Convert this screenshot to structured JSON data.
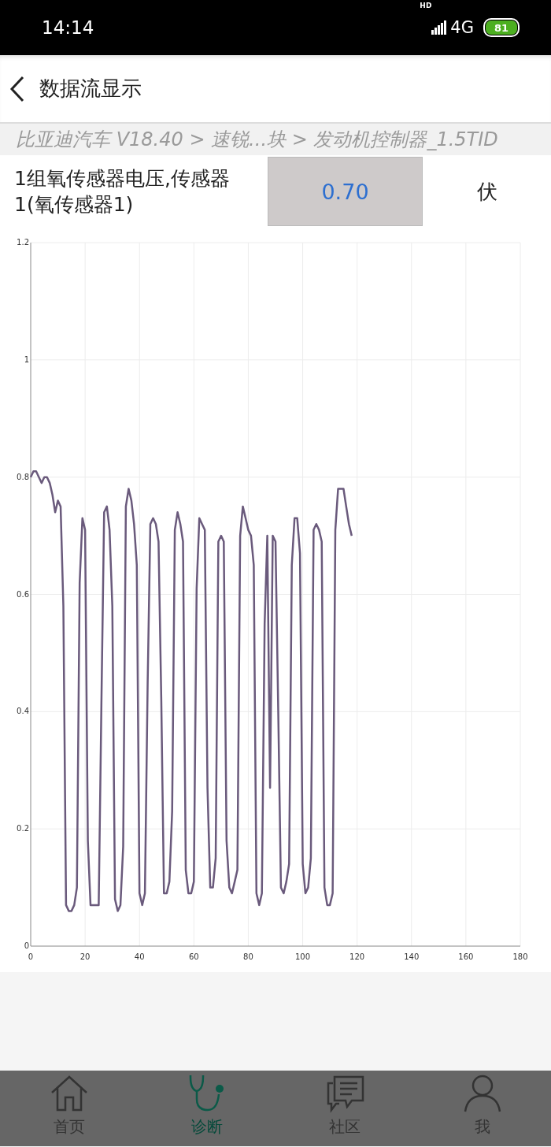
{
  "status_bar": {
    "time": "14:14",
    "signal_badge": "HD",
    "network": "4G",
    "battery": "81"
  },
  "header": {
    "title": "数据流显示"
  },
  "breadcrumb": "比亚迪汽车 V18.40 > 速锐...块 > 发动机控制器_1.5TID",
  "reading": {
    "label": "1组氧传感器电压,传感器1(氧传感器1)",
    "value": "0.70",
    "unit": "伏"
  },
  "chart_data": {
    "type": "line",
    "grid": true,
    "xlim": [
      0,
      180
    ],
    "ylim": [
      0,
      1.2
    ],
    "xticks": [
      0,
      20,
      40,
      60,
      80,
      100,
      120,
      140,
      160,
      180
    ],
    "yticks": [
      {
        "value": 0,
        "label": "0"
      },
      {
        "value": 0.2,
        "label": "0.2"
      },
      {
        "value": 0.4,
        "label": "0.4"
      },
      {
        "value": 0.6,
        "label": "0.6"
      },
      {
        "value": 0.8,
        "label": "0.8"
      },
      {
        "value": 1,
        "label": "1"
      },
      {
        "value": 1.2,
        "label": "1.2"
      }
    ],
    "x": [
      0,
      1,
      2,
      3,
      4,
      5,
      6,
      7,
      8,
      9,
      10,
      11,
      12,
      13,
      14,
      15,
      16,
      17,
      18,
      19,
      20,
      21,
      22,
      23,
      24,
      25,
      26,
      27,
      28,
      29,
      30,
      31,
      32,
      33,
      34,
      35,
      36,
      37,
      38,
      39,
      40,
      41,
      42,
      43,
      44,
      45,
      46,
      47,
      48,
      49,
      50,
      51,
      52,
      53,
      54,
      55,
      56,
      57,
      58,
      59,
      60,
      61,
      62,
      63,
      64,
      65,
      66,
      67,
      68,
      69,
      70,
      71,
      72,
      73,
      74,
      75,
      76,
      77,
      78,
      79,
      80,
      81,
      82,
      83,
      84,
      85,
      86,
      87,
      88,
      89,
      90,
      91,
      92,
      93,
      94,
      95,
      96,
      97,
      98,
      99,
      100,
      101,
      102,
      103,
      104,
      105,
      106,
      107,
      108,
      109,
      110,
      111,
      112,
      113,
      114,
      115,
      116,
      117,
      118
    ],
    "values": [
      0.8,
      0.81,
      0.81,
      0.8,
      0.79,
      0.8,
      0.8,
      0.79,
      0.77,
      0.74,
      0.76,
      0.75,
      0.58,
      0.07,
      0.06,
      0.06,
      0.07,
      0.1,
      0.62,
      0.73,
      0.71,
      0.18,
      0.07,
      0.07,
      0.07,
      0.07,
      0.41,
      0.74,
      0.75,
      0.71,
      0.58,
      0.08,
      0.06,
      0.07,
      0.17,
      0.75,
      0.78,
      0.76,
      0.72,
      0.65,
      0.09,
      0.07,
      0.09,
      0.45,
      0.72,
      0.73,
      0.72,
      0.69,
      0.42,
      0.09,
      0.09,
      0.11,
      0.23,
      0.71,
      0.74,
      0.72,
      0.69,
      0.13,
      0.09,
      0.09,
      0.11,
      0.61,
      0.73,
      0.72,
      0.71,
      0.27,
      0.1,
      0.1,
      0.15,
      0.69,
      0.7,
      0.69,
      0.18,
      0.1,
      0.09,
      0.11,
      0.13,
      0.7,
      0.75,
      0.73,
      0.71,
      0.7,
      0.65,
      0.09,
      0.07,
      0.09,
      0.55,
      0.7,
      0.27,
      0.7,
      0.69,
      0.4,
      0.1,
      0.09,
      0.11,
      0.14,
      0.65,
      0.73,
      0.73,
      0.67,
      0.14,
      0.09,
      0.1,
      0.15,
      0.71,
      0.72,
      0.71,
      0.69,
      0.1,
      0.07,
      0.07,
      0.09,
      0.71,
      0.78,
      0.78,
      0.78,
      0.75,
      0.72,
      0.7
    ]
  },
  "nav": [
    {
      "label": "首页",
      "selected": false
    },
    {
      "label": "诊断",
      "selected": true
    },
    {
      "label": "社区",
      "selected": false
    },
    {
      "label": "我",
      "selected": false
    }
  ]
}
